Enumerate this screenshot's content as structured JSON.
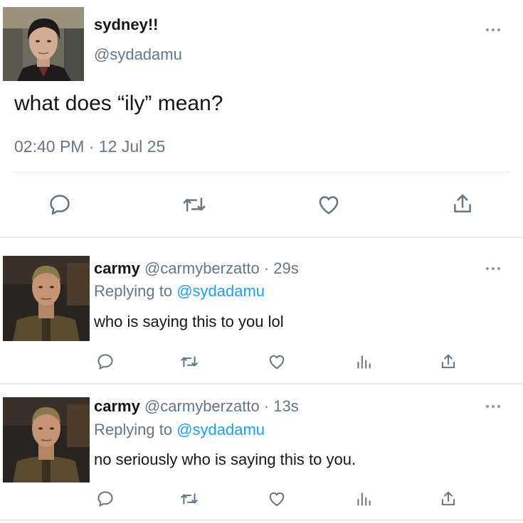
{
  "main_tweet": {
    "display_name": "sydney!!",
    "handle": "@sydadamu",
    "text": "what does “ily” mean?",
    "timestamp": "02:40 PM · 12 Jul 25",
    "actions": [
      "reply-icon",
      "retweet-icon",
      "like-icon",
      "share-icon"
    ]
  },
  "replies": [
    {
      "display_name": "carmy",
      "handle": "@carmyberzatto",
      "time": "· 29s",
      "replying_label": "Replying to",
      "replying_handle": "@sydadamu",
      "text": "who is saying this to you lol",
      "actions": [
        "reply-icon",
        "retweet-icon",
        "like-icon",
        "analytics-icon",
        "share-icon"
      ]
    },
    {
      "display_name": "carmy",
      "handle": "@carmyberzatto",
      "time": "· 13s",
      "replying_label": "Replying to",
      "replying_handle": "@sydadamu",
      "text": "no seriously who is saying this to you.",
      "actions": [
        "reply-icon",
        "retweet-icon",
        "like-icon",
        "analytics-icon",
        "share-icon"
      ]
    }
  ],
  "colors": {
    "icon_gray": "#657786",
    "link_blue": "#1da1f2",
    "divider": "#e6ecf0"
  }
}
